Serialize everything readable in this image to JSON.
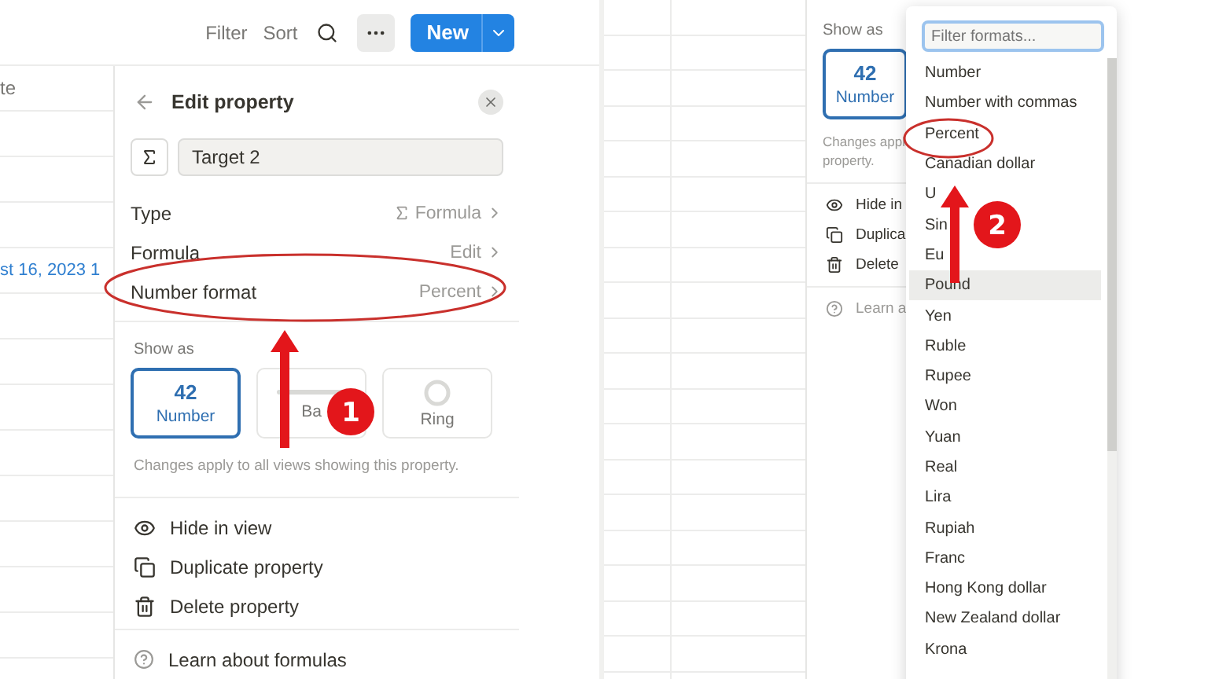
{
  "left_view": {
    "toolbar": {
      "filter": "Filter",
      "sort": "Sort",
      "new_button": "New"
    },
    "table": {
      "header": "te",
      "rows": [
        "",
        "",
        "",
        "st 16, 2023 1",
        "",
        "",
        "",
        "",
        "",
        "",
        "",
        ""
      ]
    },
    "property_panel": {
      "title": "Edit property",
      "name_value": "Target 2",
      "rows": [
        {
          "label": "Type",
          "value": "Formula",
          "value_icon": true
        },
        {
          "label": "Formula",
          "value": "Edit",
          "value_icon": false
        },
        {
          "label": "Number format",
          "value": "Percent",
          "value_icon": false
        }
      ],
      "show_as_label": "Show as",
      "show_as_options": [
        {
          "kind": "number",
          "preview": "42",
          "label": "Number",
          "selected": true
        },
        {
          "kind": "bar",
          "label": "Ba",
          "selected": false
        },
        {
          "kind": "ring",
          "label": "Ring",
          "selected": false
        }
      ],
      "note": "Changes apply to all views showing this property.",
      "actions": [
        {
          "kind": "hide",
          "label": "Hide in view"
        },
        {
          "kind": "duplicate",
          "label": "Duplicate property"
        },
        {
          "kind": "delete",
          "label": "Delete property"
        }
      ],
      "footer": "Learn about formulas"
    }
  },
  "right_view": {
    "property_panel": {
      "show_as_label": "Show as",
      "option": {
        "preview": "42",
        "label": "Number",
        "selected": true
      },
      "note_lines": [
        "Changes appl",
        "property."
      ],
      "actions": [
        {
          "kind": "hide",
          "label": "Hide in"
        },
        {
          "kind": "duplicate",
          "label": "Duplica"
        },
        {
          "kind": "delete",
          "label": "Delete"
        }
      ],
      "footer": "Learn a"
    },
    "format_menu": {
      "placeholder": "Filter formats...",
      "items": [
        {
          "label": "Number",
          "highlighted": false
        },
        {
          "label": "Number with commas",
          "highlighted": false
        },
        {
          "label": "Percent",
          "highlighted": false
        },
        {
          "label": "Canadian dollar",
          "highlighted": false
        },
        {
          "label": "U",
          "highlighted": false
        },
        {
          "label": "Sin",
          "highlighted": false
        },
        {
          "label": "Eu",
          "highlighted": false
        },
        {
          "label": "Pound",
          "highlighted": true
        },
        {
          "label": "Yen",
          "highlighted": false
        },
        {
          "label": "Ruble",
          "highlighted": false
        },
        {
          "label": "Rupee",
          "highlighted": false
        },
        {
          "label": "Won",
          "highlighted": false
        },
        {
          "label": "Yuan",
          "highlighted": false
        },
        {
          "label": "Real",
          "highlighted": false
        },
        {
          "label": "Lira",
          "highlighted": false
        },
        {
          "label": "Rupiah",
          "highlighted": false
        },
        {
          "label": "Franc",
          "highlighted": false
        },
        {
          "label": "Hong Kong dollar",
          "highlighted": false
        },
        {
          "label": "New Zealand dollar",
          "highlighted": false
        },
        {
          "label": "Krona",
          "highlighted": false
        }
      ]
    }
  },
  "annotations": [
    {
      "number": "1"
    },
    {
      "number": "2"
    }
  ]
}
